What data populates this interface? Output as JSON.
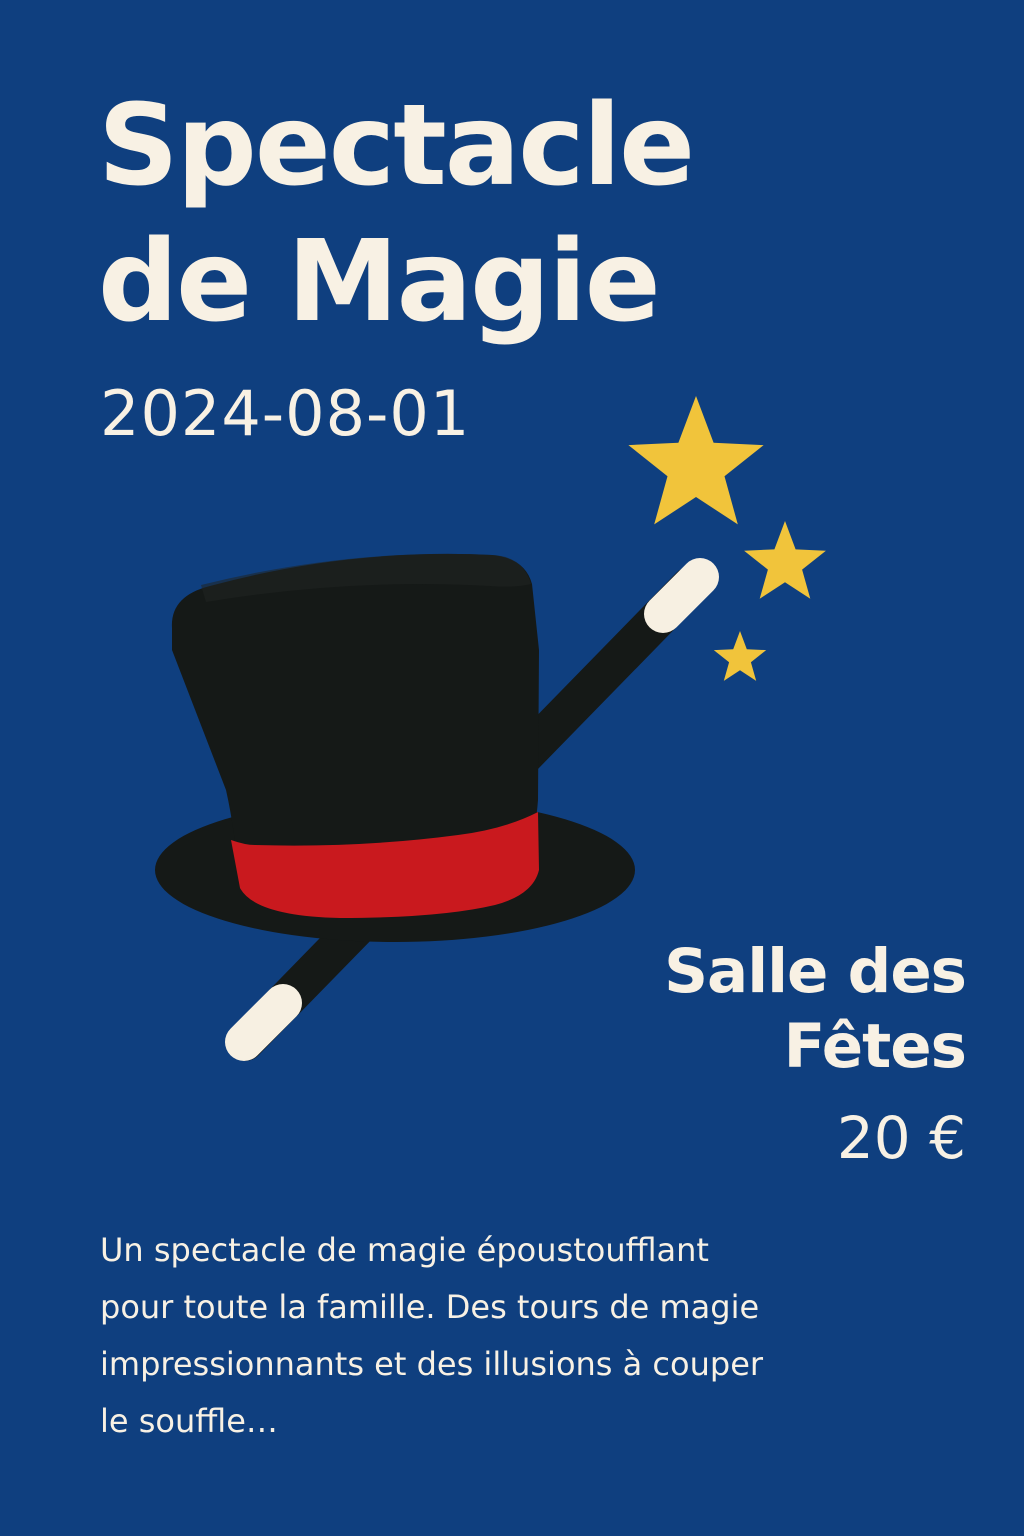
{
  "poster": {
    "title_lines": [
      "Spectacle",
      "de Magie"
    ],
    "date": "2024-08-01",
    "venue_lines": [
      "Salle des",
      "Fêtes"
    ],
    "price": "20 €",
    "description_lines": [
      "Un spectacle de magie époustoufflant",
      "pour toute la famille. Des tours de magie",
      "impressionnants et des illusions à couper",
      "le souffle…"
    ]
  },
  "colors": {
    "background": "#0f3f7f",
    "text": "#f8f1e4",
    "hat": "#151917",
    "hat_band": "#c9191e",
    "wand_tip": "#f7f0e2",
    "stars": "#f1c43b"
  },
  "icons": [
    "top-hat-icon",
    "magic-wand-icon",
    "star-icon"
  ]
}
